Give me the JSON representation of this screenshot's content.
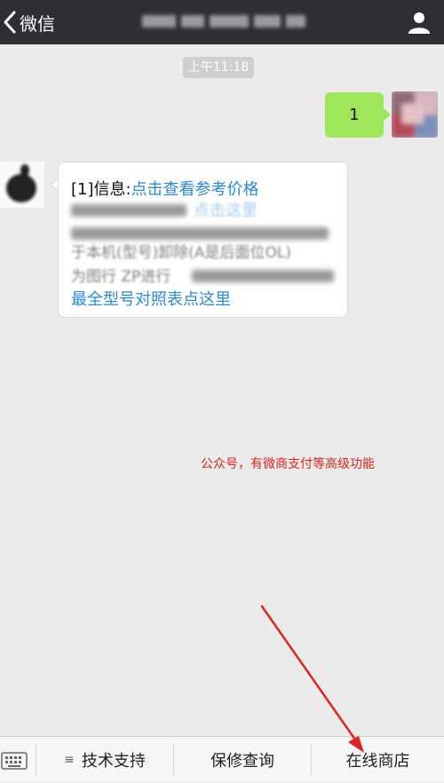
{
  "header": {
    "back_label": "微信",
    "icons": {
      "back": "chevron-left-icon",
      "profile": "user-icon"
    }
  },
  "chat": {
    "timestamp": "上午11:18",
    "sent_message": "1",
    "reply": {
      "prefix": "[1]信息:",
      "link1": "点击查看参考价格",
      "line2_partial": "点击这里",
      "line4_start": "于本机(型号)卸除(A是后面位OL)",
      "line5_start": "为图行 ZP进行",
      "link_last": "最全型号对照表点这里"
    }
  },
  "annotation": {
    "text": "公众号，有微商支付等高级功能",
    "color": "#e0231d"
  },
  "bottom_menu": {
    "keyboard_icon": "keyboard-icon",
    "menu_icon": "menu-lines-icon",
    "items": [
      "技术支持",
      "保修查询",
      "在线商店"
    ]
  },
  "colors": {
    "navbar": "#2f2f33",
    "background": "#ebebeb",
    "sent_bubble": "#a0e65a",
    "link": "#2a8ad8",
    "arrow": "#e0231d"
  }
}
